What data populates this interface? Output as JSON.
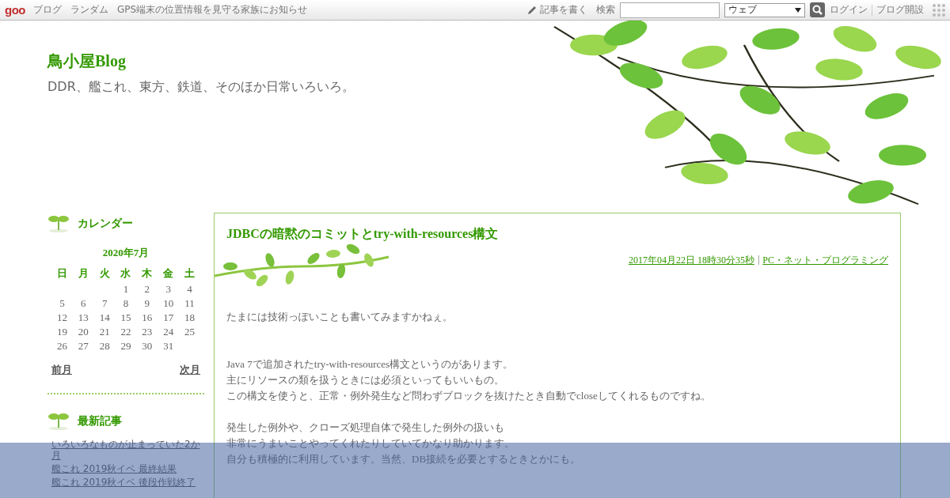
{
  "topbar": {
    "logo": "goo",
    "links": [
      "ブログ",
      "ランダム",
      "GPS端末の位置情報を見守る家族にお知らせ"
    ],
    "write": "記事を書く",
    "search_label": "検索",
    "search_scope": "ウェブ",
    "login": "ログイン",
    "open_blog": "ブログ開設"
  },
  "blog": {
    "title": "鳥小屋Blog",
    "tagline": "DDR、艦これ、東方、鉄道、そのほか日常いろいろ。"
  },
  "calendar": {
    "heading": "カレンダー",
    "month": "2020年7月",
    "weekdays": [
      "日",
      "月",
      "火",
      "水",
      "木",
      "金",
      "土"
    ],
    "weeks": [
      [
        "1",
        "2",
        "3",
        "4"
      ],
      [
        "5",
        "6",
        "7",
        "8",
        "9",
        "10",
        "11"
      ],
      [
        "12",
        "13",
        "14",
        "15",
        "16",
        "17",
        "18"
      ],
      [
        "19",
        "20",
        "21",
        "22",
        "23",
        "24",
        "25"
      ],
      [
        "26",
        "27",
        "28",
        "29",
        "30",
        "31"
      ]
    ],
    "prev": "前月",
    "next": "次月"
  },
  "recent": {
    "heading": "最新記事",
    "items": [
      "いろいろなものが止まっていた2か月",
      "艦これ 2019秋イベ 最終結果",
      "艦これ 2019秋イベ 後段作戦終了"
    ]
  },
  "post": {
    "title": "JDBCの暗黙のコミットとtry-with-resources構文",
    "date": "2017年04月22日 18時30分35秒",
    "separator": "|",
    "category": "PC・ネット・プログラミング",
    "paragraphs": [
      [
        "たまには技術っぽいことも書いてみますかねぇ。"
      ],
      [
        "Java 7で追加されたtry-with-resources構文というのがあります。",
        "主にリソースの類を扱うときには必須といってもいいもの。",
        "この構文を使うと、正常・例外発生など問わずブロックを抜けたとき自動でcloseしてくれるものですね。"
      ],
      [
        "発生した例外や、クローズ処理自体で発生した例外の扱いも",
        "非常にうまいことやってくれたりしていてかなり助かります。",
        "自分も積極的に利用しています。当然、DB接続を必要とするときとかにも。"
      ]
    ]
  }
}
